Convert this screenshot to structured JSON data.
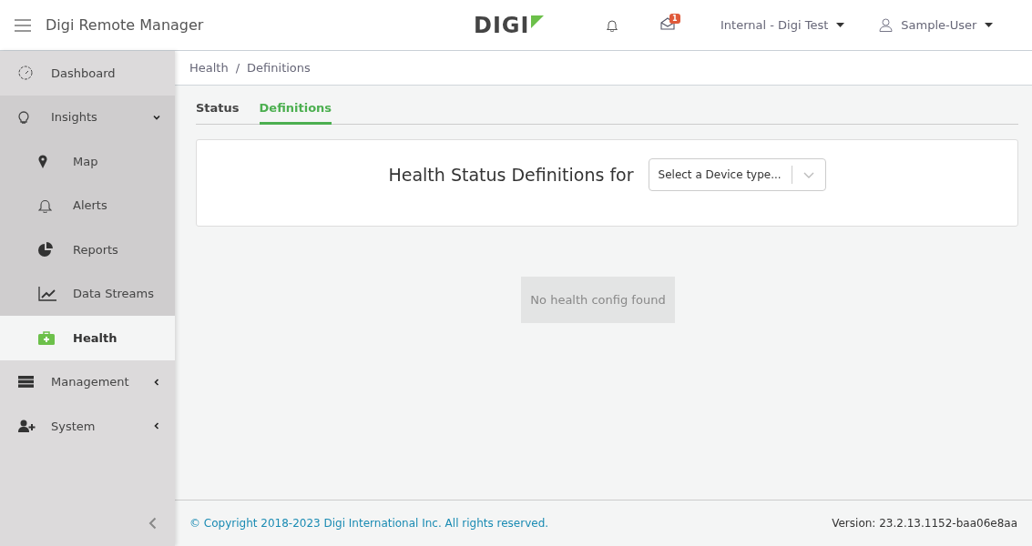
{
  "header": {
    "app_title": "Digi Remote Manager",
    "logo": "DIGI",
    "messages_badge": "1",
    "org_menu": "Internal - Digi Test",
    "user_menu": "Sample-User"
  },
  "sidebar": {
    "items": [
      {
        "label": "Dashboard",
        "selected": false
      },
      {
        "label": "Insights",
        "selected": false,
        "expanded": true,
        "children": [
          {
            "label": "Map",
            "selected": false
          },
          {
            "label": "Alerts",
            "selected": false
          },
          {
            "label": "Reports",
            "selected": false
          },
          {
            "label": "Data Streams",
            "selected": false
          },
          {
            "label": "Health",
            "selected": true
          }
        ]
      },
      {
        "label": "Management",
        "selected": false,
        "expanded": false
      },
      {
        "label": "System",
        "selected": false,
        "expanded": false
      }
    ]
  },
  "breadcrumb": [
    "Health",
    "Definitions"
  ],
  "breadcrumb_separator": "/",
  "tabs": [
    {
      "label": "Status",
      "selected": false
    },
    {
      "label": "Definitions",
      "selected": true
    }
  ],
  "definitions_card": {
    "title": "Health Status Definitions for",
    "device_type_select": {
      "placeholder": "Select a Device type..."
    }
  },
  "empty_message": "No health config found",
  "footer": {
    "copyright": "© Copyright 2018-2023 Digi International Inc. All rights reserved.",
    "version": "Version: 23.2.13.1152-baa06e8aa"
  }
}
